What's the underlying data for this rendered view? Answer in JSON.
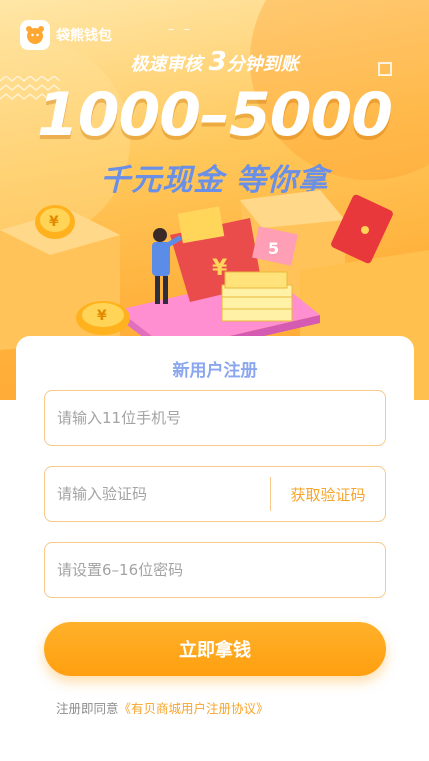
{
  "colors": {
    "brand": "#ffa733",
    "accent_blue": "#6a8fe6",
    "link": "#f6a52c",
    "field_border": "#f7c98a"
  },
  "header": {
    "app_name": "袋熊钱包",
    "decor_dashes": "– –"
  },
  "hero": {
    "slogan_a": "极速审核",
    "slogan_num": "3",
    "slogan_b": "分钟到账",
    "amount": "1000–5000",
    "subtitle": "千元现金 等你拿",
    "coin_symbol": "¥",
    "bill_mark": "5"
  },
  "form": {
    "title": "新用户注册",
    "phone_placeholder": "请输入11位手机号",
    "code_placeholder": "请输入验证码",
    "get_code_label": "获取验证码",
    "password_placeholder": "请设置6–16位密码",
    "submit_label": "立即拿钱",
    "agreement_prefix": "注册即同意",
    "agreement_link": "《有贝商城用户注册协议》"
  }
}
